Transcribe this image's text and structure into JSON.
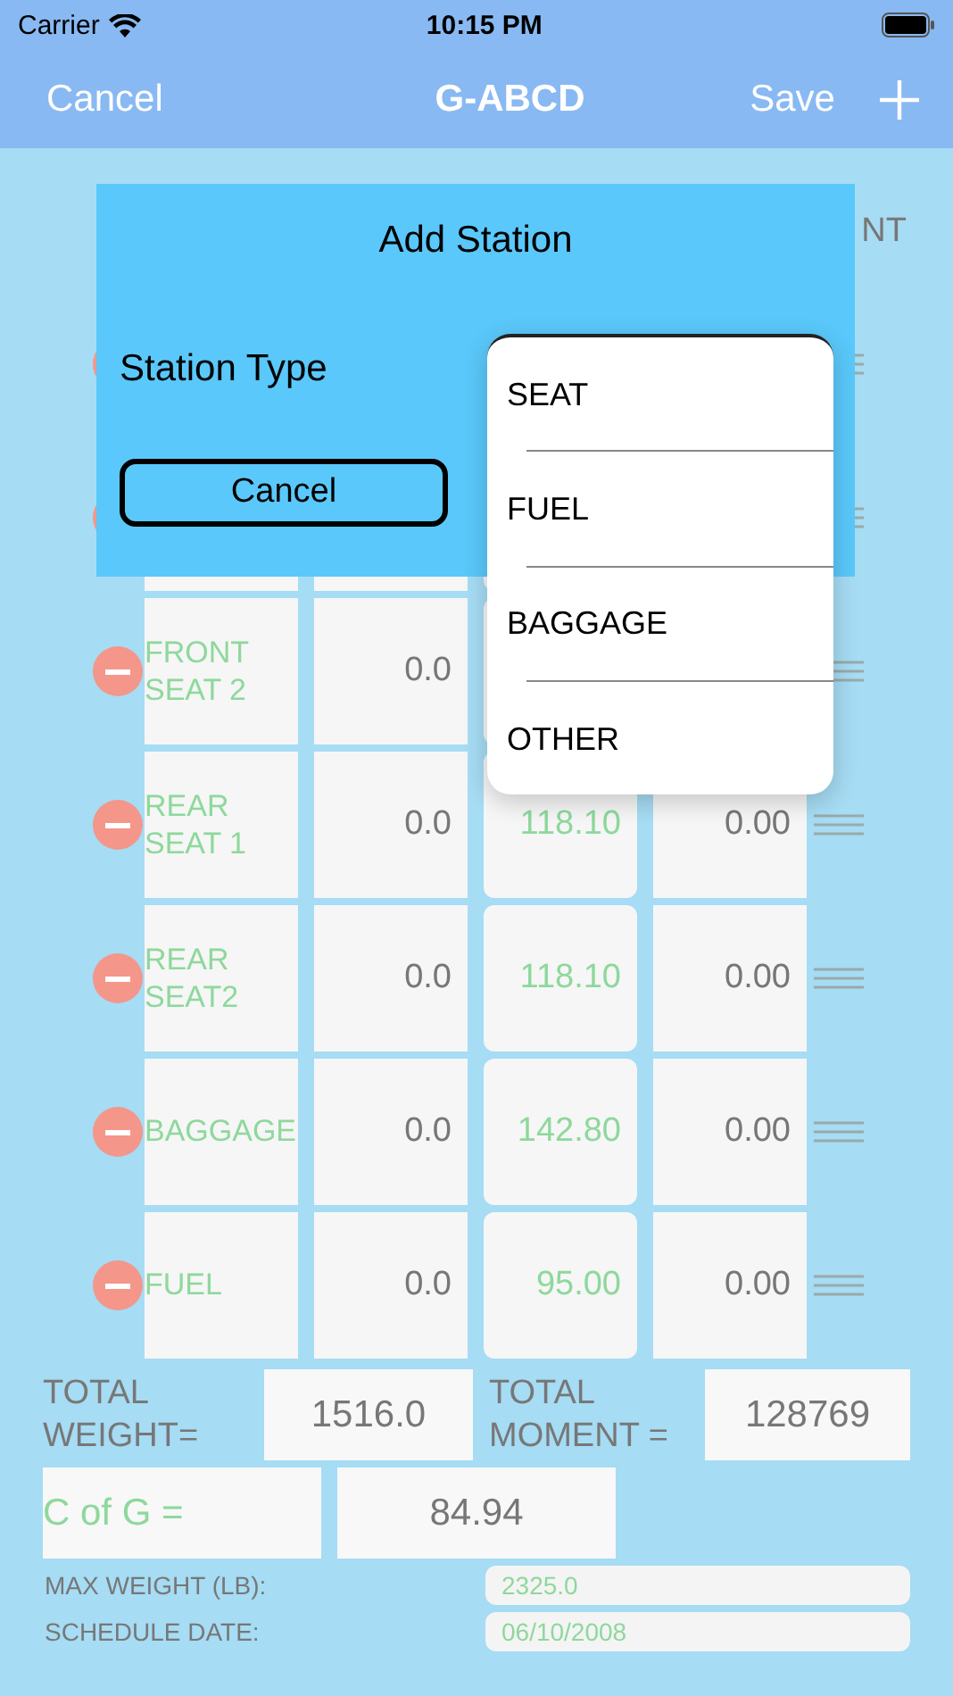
{
  "status_bar": {
    "carrier": "Carrier",
    "time": "10:15 PM"
  },
  "nav": {
    "left": "Cancel",
    "title": "G-ABCD",
    "right": "Save"
  },
  "table": {
    "header_fragment": "NT",
    "rows": [
      {
        "kind": "covered"
      },
      {
        "kind": "covered"
      },
      {
        "kind": "row",
        "name": "FRONT SEAT 2",
        "weight": "0.0"
      },
      {
        "kind": "row",
        "name": "REAR SEAT 1",
        "weight": "0.0",
        "arm": "118.10",
        "moment": "0.00"
      },
      {
        "kind": "row",
        "name": "REAR SEAT2",
        "weight": "0.0",
        "arm": "118.10",
        "moment": "0.00"
      },
      {
        "kind": "row",
        "name": "BAGGAGE",
        "weight": "0.0",
        "arm": "142.80",
        "moment": "0.00"
      },
      {
        "kind": "row",
        "name": "FUEL",
        "weight": "0.0",
        "arm": "95.00",
        "moment": "0.00"
      }
    ]
  },
  "totals": {
    "weight_label": "TOTAL WEIGHT=",
    "weight": "1516.0",
    "moment_label": "TOTAL MOMENT =",
    "moment": "128769",
    "cg_label": "C of G =",
    "cg": "84.94"
  },
  "info": [
    {
      "label": "MAX WEIGHT (LB):",
      "value": "2325.0"
    },
    {
      "label": "SCHEDULE DATE:",
      "value": "06/10/2008"
    }
  ],
  "dialog": {
    "title": "Add Station",
    "label": "Station Type",
    "cancel": "Cancel",
    "options": [
      "SEAT",
      "FUEL",
      "BAGGAGE",
      "OTHER"
    ]
  }
}
